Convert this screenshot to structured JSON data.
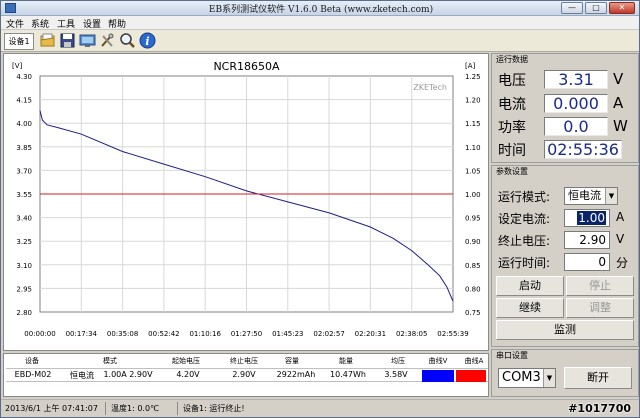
{
  "window": {
    "title": "EB系列测试仪软件 V1.6.0 Beta (www.zketech.com)",
    "min_label": "—",
    "max_label": "□",
    "close_label": "✕"
  },
  "menu": [
    "文件",
    "系统",
    "工具",
    "设置",
    "帮助"
  ],
  "toolbar": {
    "device_tab": "设备1",
    "icons": [
      "open-icon",
      "save-icon",
      "monitor-icon",
      "tools-icon",
      "zoom-icon",
      "info-icon"
    ]
  },
  "chart": {
    "title": "NCR18650A",
    "watermark": "ZKETech",
    "left_unit": "[V]",
    "right_unit": "[A]",
    "y_left_ticks": [
      "4.30",
      "4.15",
      "4.00",
      "3.85",
      "3.70",
      "3.55",
      "3.40",
      "3.25",
      "3.10",
      "2.95",
      "2.80"
    ],
    "y_right_ticks": [
      "1.25",
      "1.20",
      "1.15",
      "1.10",
      "1.05",
      "1.00",
      "0.95",
      "0.90",
      "0.85",
      "0.80",
      "0.75"
    ],
    "x_ticks": [
      "00:00:00",
      "00:17:34",
      "00:35:08",
      "00:52:42",
      "01:10:16",
      "01:27:50",
      "01:45:23",
      "02:02:57",
      "02:20:31",
      "02:38:05",
      "02:55:39"
    ]
  },
  "chart_data": {
    "type": "line",
    "title": "NCR18650A",
    "xlabel": "",
    "ylabel": "[V]",
    "y2label": "[A]",
    "ylim": [
      2.8,
      4.3
    ],
    "y2lim": [
      0.75,
      1.25
    ],
    "x_range_minutes": [
      0,
      175.65
    ],
    "grid": true,
    "series": [
      {
        "name": "",
        "axis": "left",
        "color": "#1e1e8c",
        "x_minutes": [
          0,
          1,
          3,
          8,
          17.6,
          35.1,
          52.7,
          70.3,
          87.8,
          105.4,
          123,
          140.5,
          150,
          158.1,
          165,
          170,
          173,
          175.6
        ],
        "values": [
          4.08,
          4.02,
          3.99,
          3.97,
          3.93,
          3.82,
          3.74,
          3.66,
          3.57,
          3.5,
          3.43,
          3.34,
          3.27,
          3.19,
          3.1,
          3.03,
          2.96,
          2.87
        ]
      },
      {
        "name": "",
        "axis": "right",
        "color": "#d02020",
        "x_minutes": [
          0,
          175.65
        ],
        "values": [
          1.0,
          1.0
        ]
      }
    ]
  },
  "run_data": {
    "title": "运行数据",
    "rows": [
      {
        "label": "电压",
        "value": "3.31",
        "unit": "V"
      },
      {
        "label": "电流",
        "value": "0.000",
        "unit": "A"
      },
      {
        "label": "功率",
        "value": "0.0",
        "unit": "W"
      },
      {
        "label": "时间",
        "value": "02:55:36",
        "unit": ""
      }
    ]
  },
  "params": {
    "title": "参数设置",
    "mode_label": "运行模式:",
    "mode_value": "恒电流",
    "current_label": "设定电流:",
    "current_value": "1.00",
    "current_unit": "A",
    "stopv_label": "终止电压:",
    "stopv_value": "2.90",
    "stopv_unit": "V",
    "time_label": "运行时间:",
    "time_value": "0",
    "time_unit": "分"
  },
  "buttons": {
    "start": "启动",
    "stop": "停止",
    "continue": "继续",
    "adjust": "调整",
    "monitor": "监测"
  },
  "serial": {
    "title": "串口设置",
    "port": "COM3",
    "open": "断开"
  },
  "table": {
    "headers": [
      "设备",
      "模式",
      "起始电压",
      "终止电压",
      "容量",
      "能量",
      "均压",
      "曲线V",
      "曲线A"
    ],
    "row": [
      "EBD-M02",
      "恒电流",
      "1.00A  2.90V",
      "4.20V",
      "2.90V",
      "2922mAh",
      "10.47Wh",
      "3.58V"
    ],
    "curve_v_color": "#0000ff",
    "curve_a_color": "#ff0000"
  },
  "status": {
    "datetime": "2013/6/1 上午 07:41:07",
    "temp": "温度1: 0.0℃",
    "state": "设备1: 运行终止!"
  },
  "watermark": "#1017700"
}
